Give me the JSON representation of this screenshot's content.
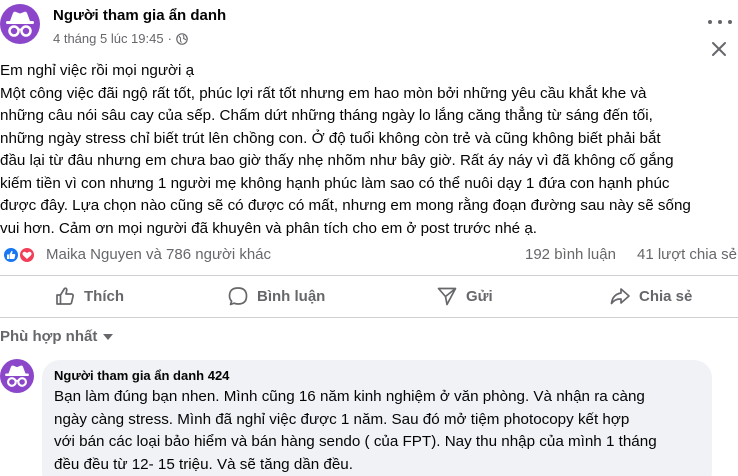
{
  "post": {
    "author": "Người tham gia ẩn danh",
    "timestamp": "4 tháng 5 lúc 19:45",
    "audience_icon": "globe-icon",
    "menu_icon": "more-options-icon",
    "close_icon": "close-icon",
    "body": "Em nghỉ việc rồi mọi người ạ\nMột công việc đãi ngộ rất tốt, phúc lợi rất tốt nhưng em hao mòn bởi những yêu cầu khắt khe và\nnhững câu nói sâu cay của sếp. Chấm dứt những tháng ngày lo lắng căng thẳng từ sáng đến tối,\nnhững ngày stress chỉ biết trút lên chồng con. Ở độ tuổi không còn trẻ và cũng không biết phải bắt\nđầu lại từ đâu nhưng em chưa bao giờ thấy nhẹ nhõm như bây giờ. Rất áy náy vì đã không cố gắng\nkiếm tiền vì con nhưng 1 người mẹ không hạnh phúc làm sao có thể nuôi dạy 1 đứa con hạnh phúc\nđược đây. Lựa chọn nào cũng sẽ có được có mất, nhưng em mong rằng đoạn đường sau này sẽ sống\nvui hơn. Cảm ơn mọi người đã khuyên và phân tích cho em ở post trước nhé ạ."
  },
  "stats": {
    "reactors": "Maika Nguyen và 786 người khác",
    "comments": "192 bình luận",
    "shares": "41 lượt chia sẻ",
    "reaction_icons": [
      "like-icon",
      "love-icon"
    ],
    "colors": {
      "like": "#1877f2",
      "love": "#f33e58"
    }
  },
  "actions": {
    "like": "Thích",
    "comment": "Bình luận",
    "send": "Gửi",
    "share": "Chia sẻ"
  },
  "comments_section": {
    "sort_label": "Phù hợp nhất",
    "first_comment": {
      "author": "Người tham gia ẩn danh 424",
      "text": "Bạn làm đúng bạn nhen. Mình cũng 16 năm kinh nghiệm ở văn phòng. Và nhận ra càng\nngày càng stress. Mình đã nghỉ việc được 1 năm. Sau đó mở tiệm photocopy kết hợp\nvới bán các loại bảo hiểm và bán hàng sendo ( của FPT). Nay thu nhập của mình 1 tháng\nđều đều từ 12- 15 triệu. Và sẽ tăng dần đều."
    }
  },
  "theme": {
    "avatar_color": "#8b46c9",
    "secondary_text": "#65676b",
    "bubble_bg": "#f0f2f5"
  }
}
